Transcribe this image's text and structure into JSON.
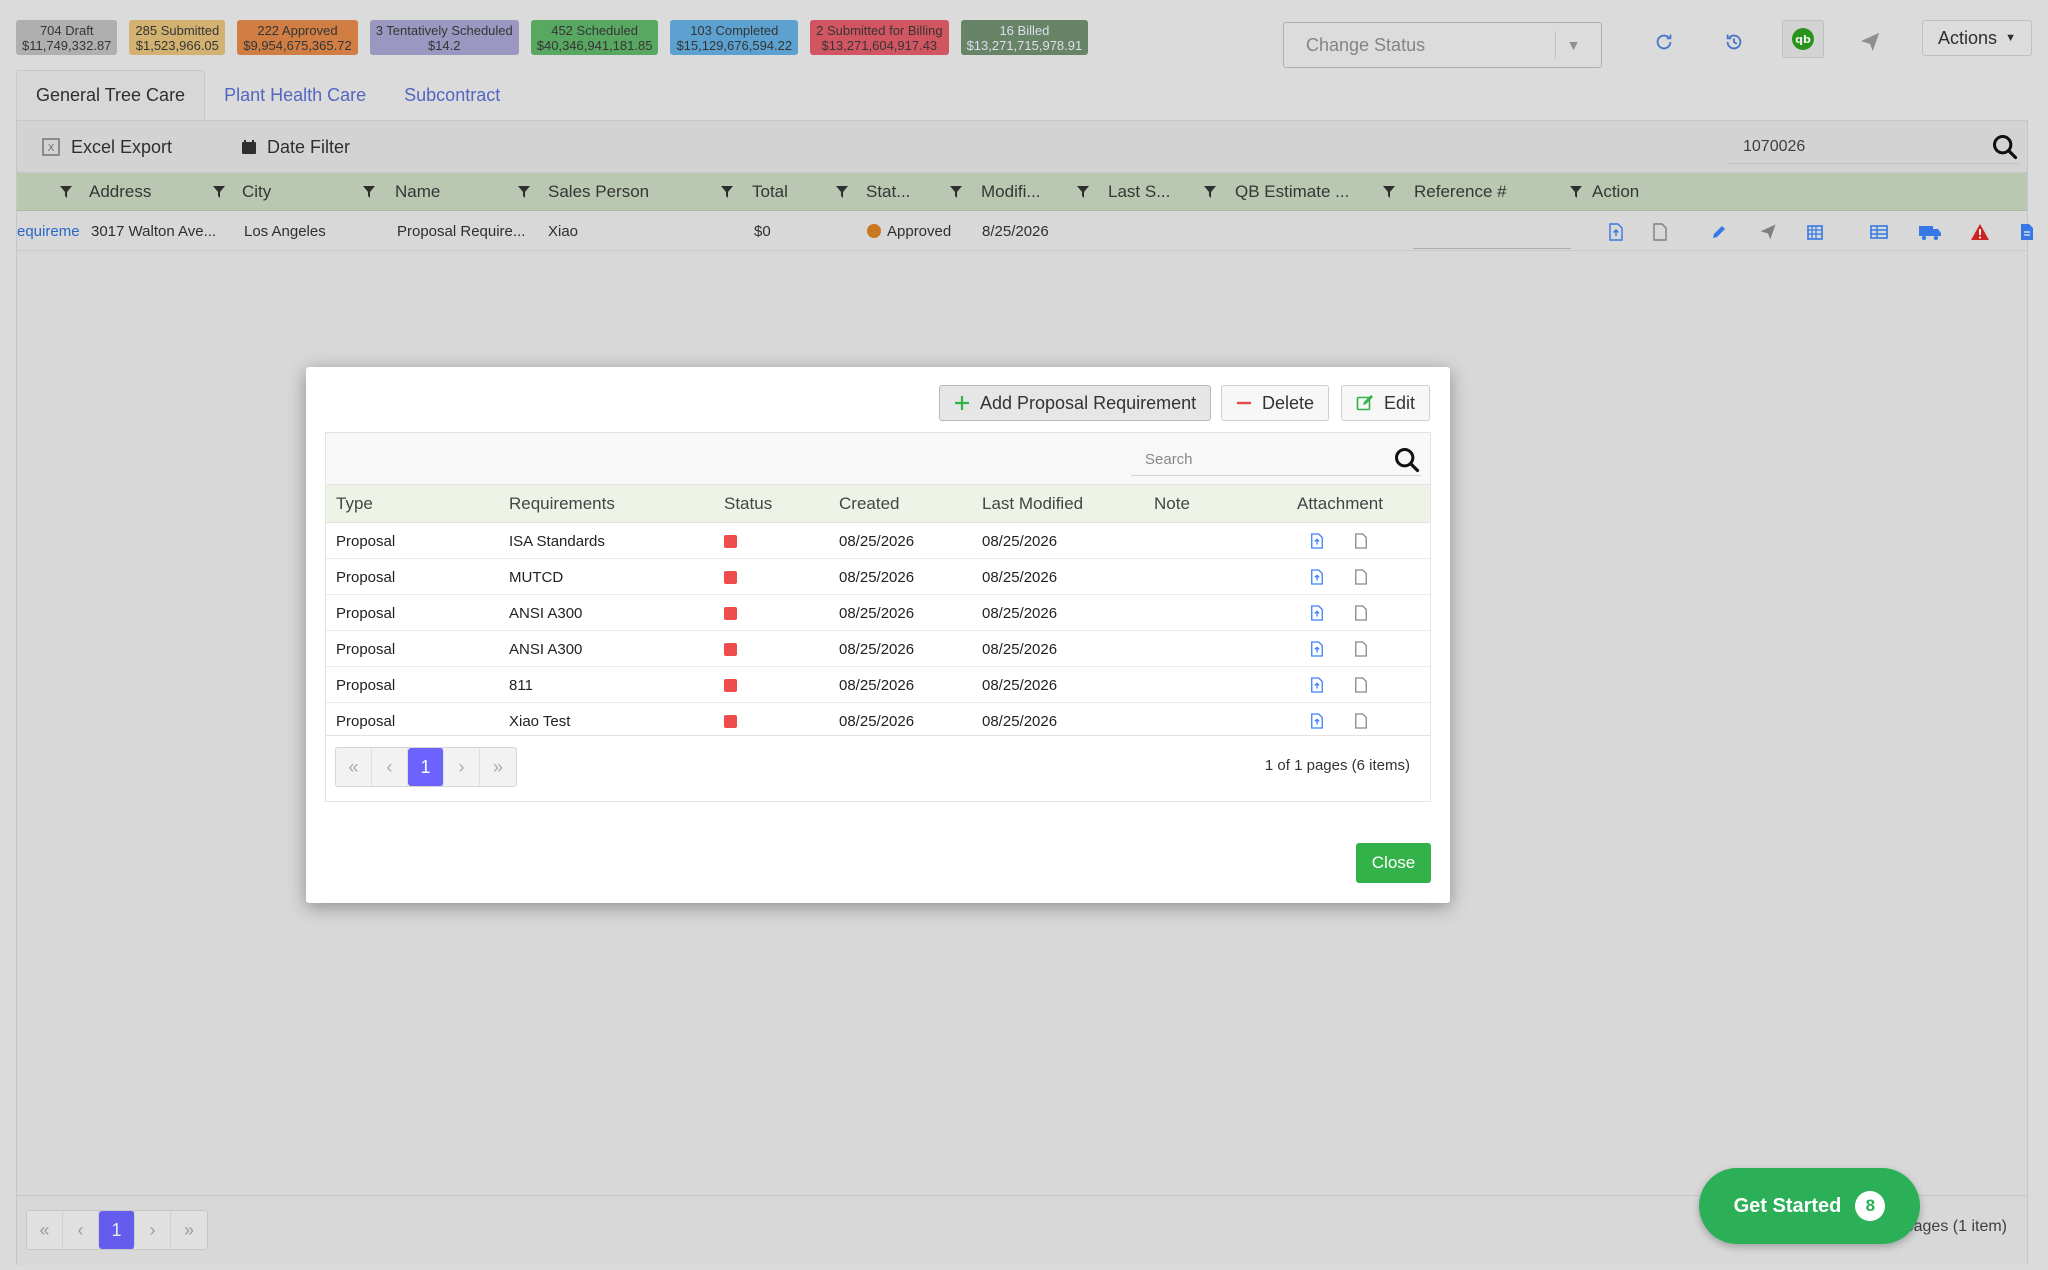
{
  "badges": [
    {
      "count": "704 Draft",
      "amount": "$11,749,332.87",
      "color": "#bdbdbd"
    },
    {
      "count": "285 Submitted",
      "amount": "$1,523,966.05",
      "color": "#e3c07a"
    },
    {
      "count": "222 Approved",
      "amount": "$9,954,675,365.72",
      "color": "#e0884a"
    },
    {
      "count": "3 Tentatively Scheduled",
      "amount": "$14.2",
      "color": "#a6a3cf"
    },
    {
      "count": "452 Scheduled",
      "amount": "$40,346,941,181.85",
      "color": "#5fb56a"
    },
    {
      "count": "103 Completed",
      "amount": "$15,129,676,594.22",
      "color": "#63aee0"
    },
    {
      "count": "2 Submitted for Billing",
      "amount": "$13,271,604,917.43",
      "color": "#e25c6a"
    },
    {
      "count": "16 Billed",
      "amount": "$13,271,715,978.91",
      "color": "#6f8f6f"
    }
  ],
  "header": {
    "change_status_placeholder": "Change Status",
    "actions_label": "Actions"
  },
  "tabs": [
    {
      "label": "General Tree Care"
    },
    {
      "label": "Plant Health Care"
    },
    {
      "label": "Subcontract"
    }
  ],
  "grid": {
    "excel_export": "Excel Export",
    "date_filter": "Date Filter",
    "search_value": "1070026",
    "columns": [
      "Address",
      "City",
      "Name",
      "Sales Person",
      "Total",
      "Stat...",
      "Modifi...",
      "Last S...",
      "QB Estimate ...",
      "Reference #",
      "Action"
    ],
    "row": {
      "link": "equireme",
      "address": "3017 Walton Ave...",
      "city": "Los Angeles",
      "name": "Proposal Require...",
      "sales_person": "Xiao",
      "total": "$0",
      "status": "Approved",
      "modified": "8/25/2026"
    },
    "page": "1",
    "footer_info": "pages (1 item)"
  },
  "modal": {
    "add_label": "Add Proposal Requirement",
    "delete_label": "Delete",
    "edit_label": "Edit",
    "search_placeholder": "Search",
    "columns": [
      "Type",
      "Requirements",
      "Status",
      "Created",
      "Last Modified",
      "Note",
      "Attachment"
    ],
    "rows": [
      {
        "type": "Proposal",
        "requirement": "ISA Standards",
        "created": "08/25/2026",
        "modified": "08/25/2026",
        "note": ""
      },
      {
        "type": "Proposal",
        "requirement": "MUTCD",
        "created": "08/25/2026",
        "modified": "08/25/2026",
        "note": ""
      },
      {
        "type": "Proposal",
        "requirement": "ANSI A300",
        "created": "08/25/2026",
        "modified": "08/25/2026",
        "note": ""
      },
      {
        "type": "Proposal",
        "requirement": "ANSI A300",
        "created": "08/25/2026",
        "modified": "08/25/2026",
        "note": ""
      },
      {
        "type": "Proposal",
        "requirement": "811",
        "created": "08/25/2026",
        "modified": "08/25/2026",
        "note": ""
      },
      {
        "type": "Proposal",
        "requirement": "Xiao Test",
        "created": "08/25/2026",
        "modified": "08/25/2026",
        "note": ""
      }
    ],
    "page": "1",
    "pager_info": "1 of 1 pages (6 items)",
    "close_label": "Close"
  },
  "get_started": {
    "label": "Get Started",
    "count": "8"
  },
  "colors": {
    "accent": "#6c63ff",
    "green": "#33b249",
    "link": "#5a6fd0",
    "danger": "#ef4d4d"
  }
}
